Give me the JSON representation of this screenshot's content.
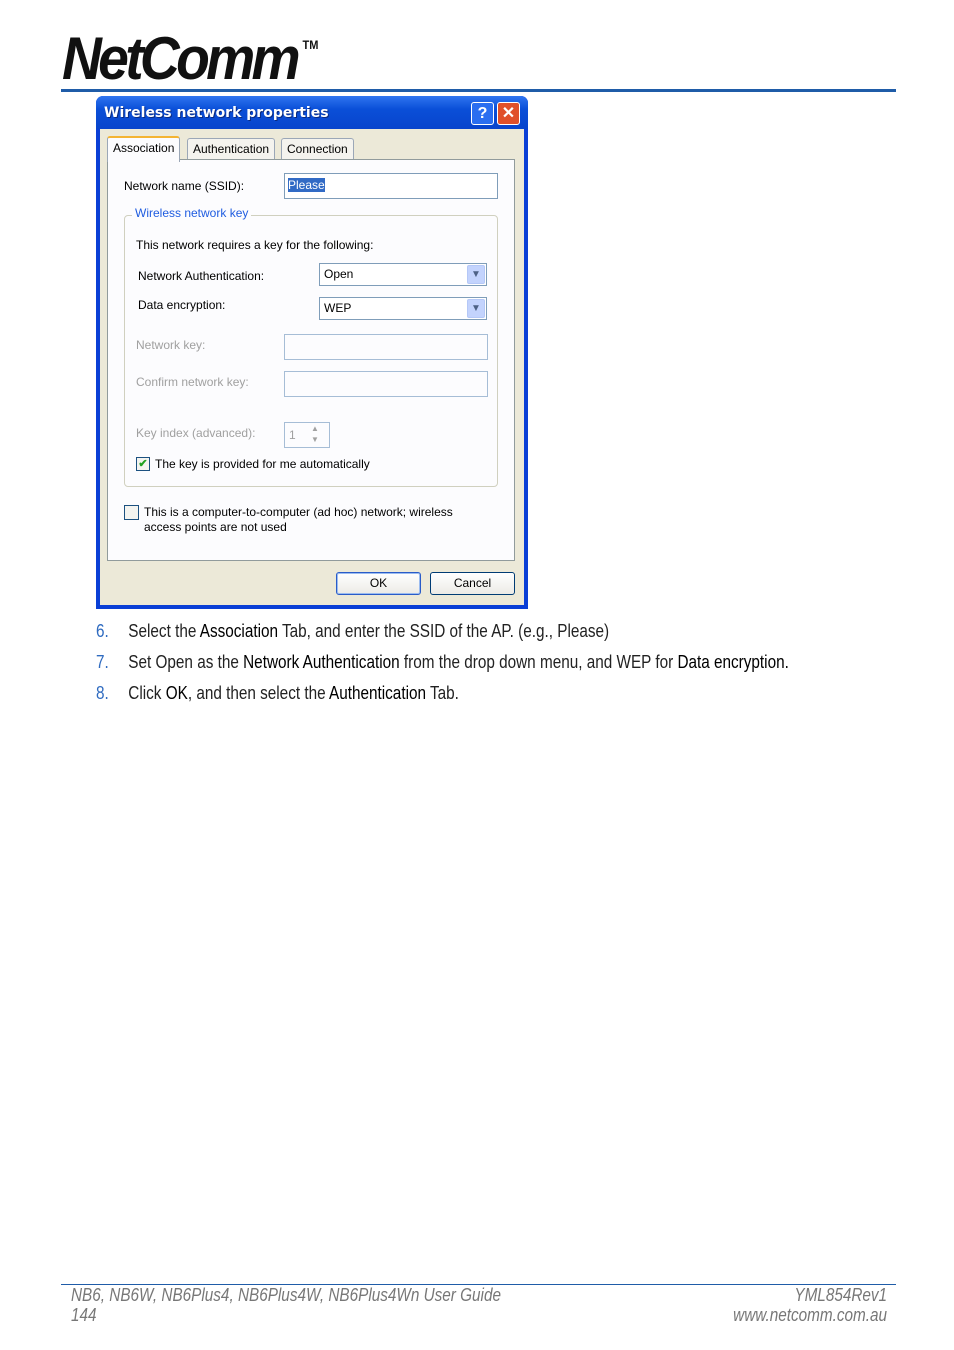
{
  "header": {
    "logo_text": "NetComm",
    "logo_tm": "TM"
  },
  "dialog": {
    "title": "Wireless network properties",
    "help_glyph": "?",
    "close_glyph": "✕",
    "tabs": [
      "Association",
      "Authentication",
      "Connection"
    ],
    "active_tab": "Association",
    "ssid_label": "Network name (SSID):",
    "ssid_value": "Please",
    "group_title": "Wireless network key",
    "requires_text": "This network requires a key for the following:",
    "auth_label": "Network Authentication:",
    "auth_value": "Open",
    "enc_label": "Data encryption:",
    "enc_value": "WEP",
    "netkey_label": "Network key:",
    "confirm_label": "Confirm network key:",
    "keyindex_label": "Key index (advanced):",
    "keyindex_value": "1",
    "auto_key_label": "The key is provided for me automatically",
    "auto_key_checked": true,
    "adhoc_label_1": "This is a computer-to-computer (ad hoc) network; wireless",
    "adhoc_label_2": "access points are not used",
    "adhoc_checked": false,
    "ok_label": "OK",
    "cancel_label": "Cancel"
  },
  "steps": [
    {
      "num": "6.",
      "parts": [
        "Select the ",
        "Association",
        " Tab, and enter the SSID of the AP. (e.g., Please)"
      ]
    },
    {
      "num": "7.",
      "parts": [
        "Set Open as the ",
        "Network Authentication",
        " from the drop down menu, and WEP for ",
        "Data encryption."
      ]
    },
    {
      "num": "8.",
      "parts": [
        "Click ",
        "OK",
        ", and then select the ",
        "Authentication",
        " Tab."
      ]
    }
  ],
  "footer": {
    "guide": "NB6, NB6W, NB6Plus4, NB6Plus4W, NB6Plus4Wn User Guide",
    "page": "144",
    "rev": "YML854Rev1",
    "url": "www.netcomm.com.au"
  },
  "colors": {
    "brand_blue": "#1f5ca8",
    "xp_title": "#0a4fd8",
    "step_number": "#2f6bc0"
  }
}
